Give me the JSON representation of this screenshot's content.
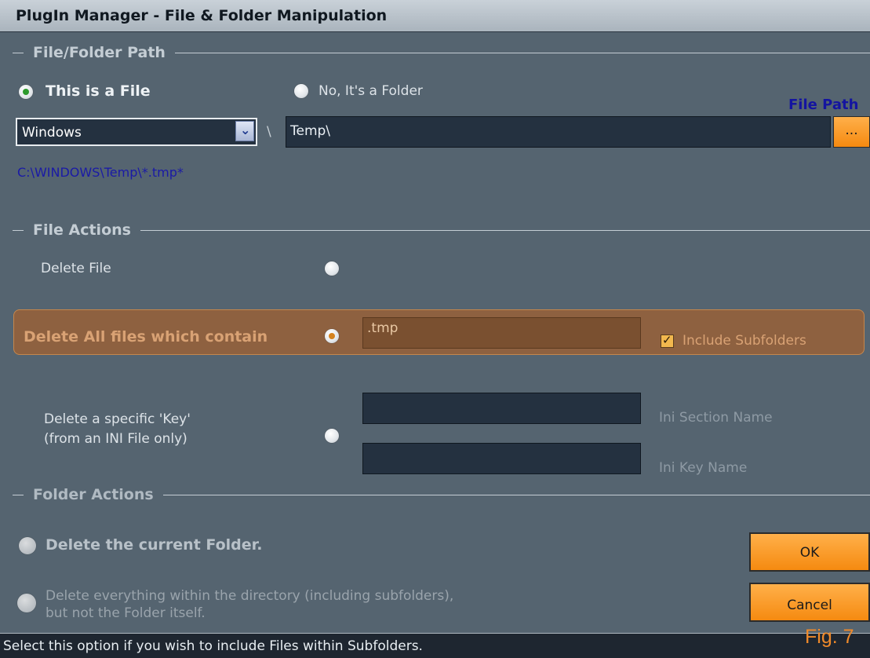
{
  "window": {
    "title": "PlugIn Manager - File & Folder Manipulation"
  },
  "path_group": {
    "title": "File/Folder Path",
    "radio_file": "This is a File",
    "radio_folder": "No, It's a Folder",
    "file_path_label": "File Path",
    "combo_value": "Windows",
    "separator": "\\",
    "path_value": "Temp\\",
    "browse_label": "...",
    "resolved_path": "C:\\WINDOWS\\Temp\\*.tmp*"
  },
  "file_actions": {
    "title": "File Actions",
    "delete_file": "Delete File",
    "delete_all": "Delete All files which contain",
    "delete_all_value": ".tmp",
    "include_subfolders": "Include Subfolders",
    "delete_key_line1": "Delete a specific 'Key'",
    "delete_key_line2": "(from an INI File only)",
    "ini_section_label": "Ini Section Name",
    "ini_key_label": "Ini Key Name"
  },
  "folder_actions": {
    "title": "Folder Actions",
    "delete_folder": "Delete the current Folder.",
    "delete_contents_line1": "Delete everything within the directory (including subfolders),",
    "delete_contents_line2": "but not the Folder itself."
  },
  "buttons": {
    "ok": "OK",
    "cancel": "Cancel"
  },
  "status": {
    "text": "Select this option if you wish to include Files within Subfolders."
  },
  "figure_label": "Fig. 7",
  "colors": {
    "background": "#556470",
    "accent": "#f58a10",
    "highlight": "#8e6140",
    "link_text": "#1414a0"
  }
}
